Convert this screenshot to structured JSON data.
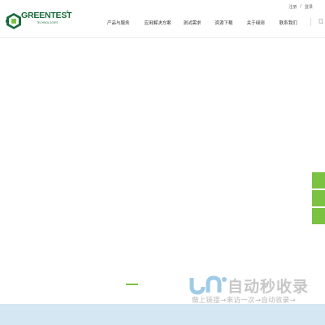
{
  "header": {
    "logo": {
      "name": "GREENTEST",
      "sub": "TECHNOLOGIES",
      "reg": "®"
    },
    "top_links": {
      "register": "注册",
      "sep": "/",
      "login": "登录"
    },
    "nav": [
      {
        "label": "产品与服务"
      },
      {
        "label": "应用解决方案"
      },
      {
        "label": "测试需求"
      },
      {
        "label": "资源下载"
      },
      {
        "label": "关于绿测"
      },
      {
        "label": "联系我们"
      }
    ]
  },
  "watermark": {
    "title": "自动秒收录",
    "subtitle": "做上链接→来访一次→自动收录→"
  },
  "colors": {
    "accent": "#7bc142",
    "brand": "#1a6b3c",
    "band": "#d6e7f4"
  }
}
